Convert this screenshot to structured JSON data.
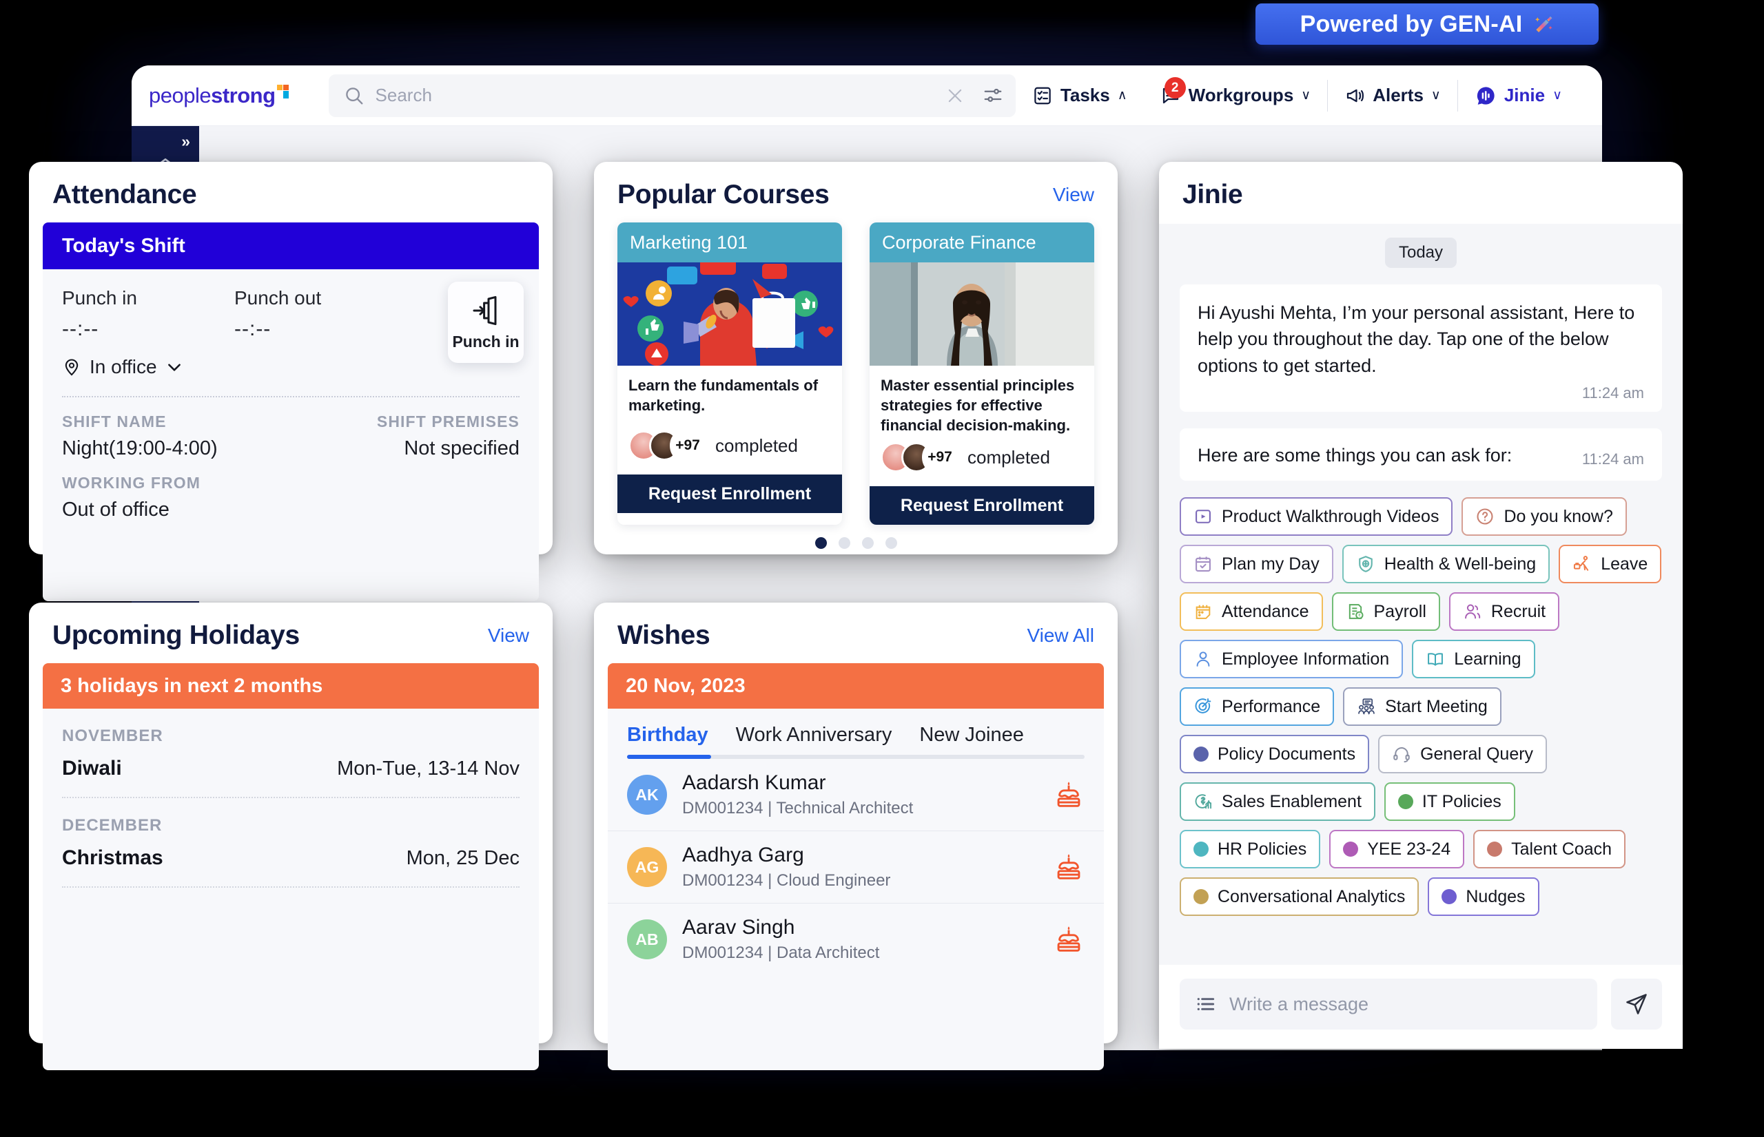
{
  "banner": {
    "text": "Powered by GEN-AI",
    "icon": "magic-wand-icon",
    "bg": "#3a63e8"
  },
  "topbar": {
    "logo": {
      "part1": "people",
      "part2": "strong"
    },
    "search": {
      "placeholder": "Search",
      "value": ""
    },
    "nav": [
      {
        "label": "Tasks",
        "icon": "tasks-icon",
        "chevron": "∧",
        "badge": null
      },
      {
        "label": "Workgroups",
        "icon": "workgroups-icon",
        "chevron": "∨",
        "badge": "2"
      },
      {
        "label": "Alerts",
        "icon": "megaphone-icon",
        "chevron": "∨",
        "badge": null
      },
      {
        "label": "Jinie",
        "icon": "jinie-icon",
        "chevron": "∨",
        "badge": null
      }
    ]
  },
  "rail": {
    "expand": "»",
    "items": [
      "home-icon",
      "analytics-icon"
    ]
  },
  "attendance": {
    "title": "Attendance",
    "shift_header": "Today's Shift",
    "punch_in_label": "Punch in",
    "punch_in_value": "--:--",
    "punch_out_label": "Punch out",
    "punch_out_value": "--:--",
    "location": "In office",
    "punch_button": "Punch in",
    "shift_name_label": "SHIFT NAME",
    "shift_name_value": "Night(19:00-4:00)",
    "shift_premises_label": "SHIFT PREMISES",
    "shift_premises_value": "Not specified",
    "working_from_label": "WORKING FROM",
    "working_from_value": "Out of office"
  },
  "courses": {
    "title": "Popular  Courses",
    "view": "View",
    "items": [
      {
        "name": "Marketing 101",
        "desc": "Learn the fundamentals of marketing.",
        "count": "+97",
        "completed": "completed",
        "cta": "Request Enrollment"
      },
      {
        "name": "Corporate Finance",
        "desc": "Master essential principles strategies for effective financial decision-making.",
        "count": "+97",
        "completed": "completed",
        "cta": "Request Enrollment"
      }
    ],
    "carousel": {
      "total": 4,
      "active": 0
    }
  },
  "holidays": {
    "title": "Upcoming Holidays",
    "view": "View",
    "summary": "3 holidays in next 2 months",
    "groups": [
      {
        "month": "NOVEMBER",
        "name": "Diwali",
        "date": "Mon-Tue, 13-14 Nov"
      },
      {
        "month": "DECEMBER",
        "name": "Christmas",
        "date": "Mon, 25 Dec"
      }
    ]
  },
  "wishes": {
    "title": "Wishes",
    "view_all": "View All",
    "date": "20 Nov, 2023",
    "tabs": [
      {
        "label": "Birthday",
        "active": true
      },
      {
        "label": "Work Anniversary",
        "active": false
      },
      {
        "label": "New Joinee",
        "active": false
      }
    ],
    "people": [
      {
        "initials": "AK",
        "color": "#63a0ee",
        "name": "Aadarsh Kumar",
        "detail": "DM001234 | Technical Architect",
        "icon": "birthday-cake-icon"
      },
      {
        "initials": "AG",
        "color": "#f6b756",
        "name": "Aadhya Garg",
        "detail": "DM001234 | Cloud Engineer",
        "icon": "birthday-cake-icon"
      },
      {
        "initials": "AB",
        "color": "#8cd39a",
        "name": "Aarav Singh",
        "detail": "DM001234 | Data Architect",
        "icon": "birthday-cake-icon"
      }
    ]
  },
  "jinie": {
    "title": "Jinie",
    "day_divider": "Today",
    "messages": [
      {
        "text": "Hi Ayushi Mehta, I’m your personal assistant, Here to help you throughout the day. Tap one of the below options to get started.",
        "time": "11:24 am"
      },
      {
        "text": "Here are some things you can ask for:",
        "time": "11:24 am"
      }
    ],
    "chips": [
      {
        "label": "Product Walkthrough Videos",
        "icon": "play-video-icon",
        "color": "#7b68b8"
      },
      {
        "label": "Do you know?",
        "icon": "question-circle-icon",
        "color": "#c98272"
      },
      {
        "label": "Plan my Day",
        "icon": "calendar-check-icon",
        "color": "#a48fc4"
      },
      {
        "label": "Health & Well-being",
        "icon": "shield-plus-icon",
        "color": "#63b5ad"
      },
      {
        "label": "Leave",
        "icon": "traveler-icon",
        "color": "#ef7a46"
      },
      {
        "label": "Attendance",
        "icon": "calendar-pen-icon",
        "color": "#f0b13f"
      },
      {
        "label": "Payroll",
        "icon": "payslip-icon",
        "color": "#5aab5f"
      },
      {
        "label": "Recruit",
        "icon": "people-plus-icon",
        "color": "#a85eb5"
      },
      {
        "label": "Employee Information",
        "icon": "person-icon",
        "color": "#5a8fe0"
      },
      {
        "label": "Learning",
        "icon": "open-book-icon",
        "color": "#3ea9b6"
      },
      {
        "label": "Performance",
        "icon": "target-icon",
        "color": "#3896db"
      },
      {
        "label": "Start Meeting",
        "icon": "meeting-icon",
        "color": "#3b4a72"
      },
      {
        "label": "Policy Documents",
        "icon": "dot-icon",
        "color": "#5a63ab"
      },
      {
        "label": "General Query",
        "icon": "headset-icon",
        "color": "#8b90a3"
      },
      {
        "label": "Sales Enablement",
        "icon": "sales-growth-icon",
        "color": "#4fa79b"
      },
      {
        "label": "IT Policies",
        "icon": "dot-icon",
        "color": "#58a85a"
      },
      {
        "label": "HR Policies",
        "icon": "dot-icon",
        "color": "#4eb6c0"
      },
      {
        "label": "YEE 23-24",
        "icon": "dot-icon",
        "color": "#ae5bb5"
      },
      {
        "label": "Talent Coach",
        "icon": "dot-icon",
        "color": "#c87a6c"
      },
      {
        "label": "Conversational Analytics",
        "icon": "dot-icon",
        "color": "#c2a154"
      },
      {
        "label": "Nudges",
        "icon": "dot-icon",
        "color": "#6e5ed0"
      }
    ],
    "composer": {
      "placeholder": "Write a message",
      "value": "",
      "list_icon": "list-icon",
      "send_icon": "send-icon"
    }
  }
}
